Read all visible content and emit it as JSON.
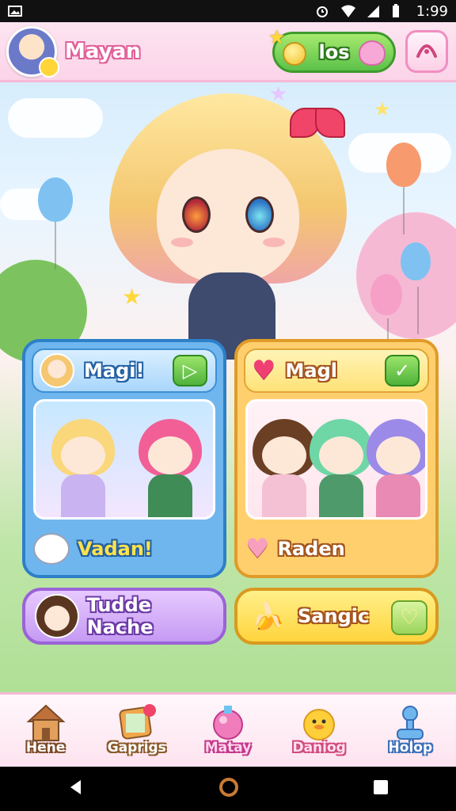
{
  "status_bar": {
    "time": "1:99"
  },
  "header": {
    "username": "Mayan",
    "currency_label": "los"
  },
  "cards": [
    {
      "title": "Magi!",
      "footer": "Vadan!"
    },
    {
      "title": "Magl",
      "footer": "Raden"
    }
  ],
  "wide_buttons": [
    {
      "label": "Tudde Nache"
    },
    {
      "label": "Sangic"
    }
  ],
  "nav": [
    {
      "label": "Hene",
      "icon": "house-icon"
    },
    {
      "label": "Gaprigs",
      "icon": "gallery-icon"
    },
    {
      "label": "Matay",
      "icon": "potion-icon"
    },
    {
      "label": "Daniog",
      "icon": "duck-icon"
    },
    {
      "label": "Holop",
      "icon": "help-icon"
    }
  ],
  "colors": {
    "header_bg": "#fbd4e8",
    "accent_green": "#5cc14a",
    "card_blue": "#6fb6ee",
    "card_orange": "#ffcf6e",
    "button_purple": "#c59af3",
    "button_yellow": "#ffd43d"
  }
}
